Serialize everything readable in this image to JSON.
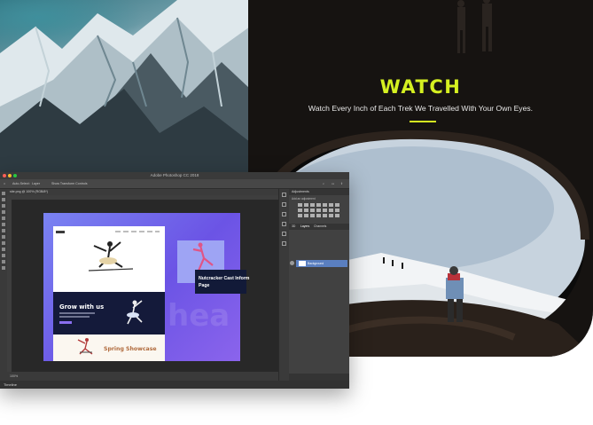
{
  "promo": {
    "title": "WATCH",
    "subtitle": "Watch Every Inch of Each Trek We Travelled With Your Own Eyes.",
    "accent_color": "#d5f021"
  },
  "photoshop": {
    "window_title": "Adobe Photoshop CC 2018",
    "options_bar": {
      "auto_select": "Auto-Select:",
      "layer": "Layer",
      "transform": "Show Transform Controls"
    },
    "document_tab": "site.png @ 100% (RGB/8*)",
    "status_zoom": "100%",
    "timeline_label": "Timeline",
    "adjustments_panel": {
      "title": "Adjustments",
      "subtitle": "Add an adjustment"
    },
    "layers_panel": {
      "tabs": [
        "3D",
        "Layers",
        "Channels"
      ],
      "layer_name": "Background"
    },
    "tool_icons": [
      "move-icon",
      "marquee-icon",
      "lasso-icon",
      "crop-icon",
      "eyedropper-icon",
      "brush-icon",
      "stamp-icon",
      "eraser-icon",
      "gradient-icon",
      "pen-icon",
      "type-icon",
      "hand-icon",
      "zoom-icon"
    ]
  },
  "artboard": {
    "section2_heading": "Grow with us",
    "section3_heading": "Spring Showcase",
    "card_caption_line1": "Nutcracker Cast Inform",
    "card_caption_line2": "Page",
    "watermark": "hea"
  }
}
